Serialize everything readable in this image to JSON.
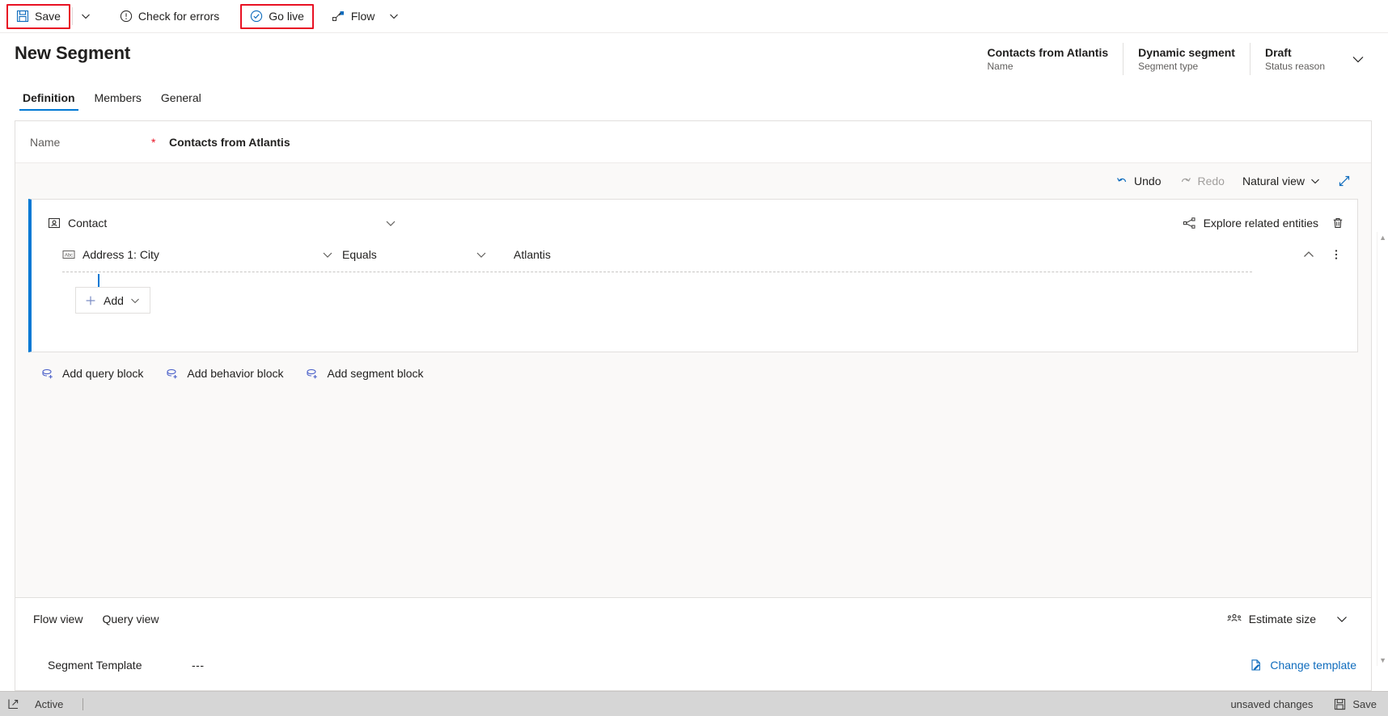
{
  "commandbar": {
    "save_label": "Save",
    "save_caret_icon": "chevron-down-icon",
    "check_errors_label": "Check for errors",
    "go_live_label": "Go live",
    "flow_label": "Flow",
    "flow_caret_icon": "chevron-down-icon",
    "highlight_color": "#e81123"
  },
  "header": {
    "title": "New Segment",
    "meta": [
      {
        "value": "Contacts from Atlantis",
        "label": "Name"
      },
      {
        "value": "Dynamic segment",
        "label": "Segment type"
      },
      {
        "value": "Draft",
        "label": "Status reason"
      }
    ],
    "expand_icon": "chevron-down-icon"
  },
  "tabs": [
    {
      "label": "Definition",
      "active": true
    },
    {
      "label": "Members",
      "active": false
    },
    {
      "label": "General",
      "active": false
    }
  ],
  "form": {
    "name_label": "Name",
    "required_marker": "*",
    "name_value": "Contacts from Atlantis"
  },
  "builder_toolbar": {
    "undo_label": "Undo",
    "redo_label": "Redo",
    "view_label": "Natural view",
    "view_caret_icon": "chevron-down-icon",
    "expand_icon": "expand-diagonal-icon"
  },
  "entity_block": {
    "accent_color": "#0078d4",
    "entity_icon": "contact-entity-icon",
    "entity_label": "Contact",
    "collapse_icon": "chevron-down-icon",
    "explore_label": "Explore related entities",
    "explore_icon": "share-nodes-icon",
    "delete_icon": "trash-icon",
    "condition": {
      "field_icon": "abc-text-icon",
      "field": "Address 1: City",
      "field_caret_icon": "chevron-down-icon",
      "operator": "Equals",
      "operator_caret_icon": "chevron-down-icon",
      "value": "Atlantis",
      "collapse_icon": "chevron-up-icon",
      "more_icon": "more-vertical-icon"
    },
    "add_button": {
      "label": "Add",
      "plus_icon": "plus-icon",
      "caret_icon": "chevron-down-icon"
    }
  },
  "block_links": [
    {
      "label": "Add query block",
      "icon": "add-query-block-icon"
    },
    {
      "label": "Add behavior block",
      "icon": "add-behavior-block-icon"
    },
    {
      "label": "Add segment block",
      "icon": "add-segment-block-icon"
    }
  ],
  "bottom_panel": {
    "views": [
      {
        "label": "Flow view"
      },
      {
        "label": "Query view"
      }
    ],
    "estimate_label": "Estimate size",
    "estimate_icon": "people-icon",
    "estimate_caret_icon": "chevron-down-icon",
    "template_label": "Segment Template",
    "template_value": "---",
    "change_template_label": "Change template",
    "change_template_icon": "document-edit-icon",
    "link_color": "#0f6cbd"
  },
  "statusbar": {
    "expand_icon": "popout-icon",
    "status_text": "Active",
    "unsaved_text": "unsaved changes",
    "save_label": "Save",
    "save_icon": "save-disk-icon"
  }
}
